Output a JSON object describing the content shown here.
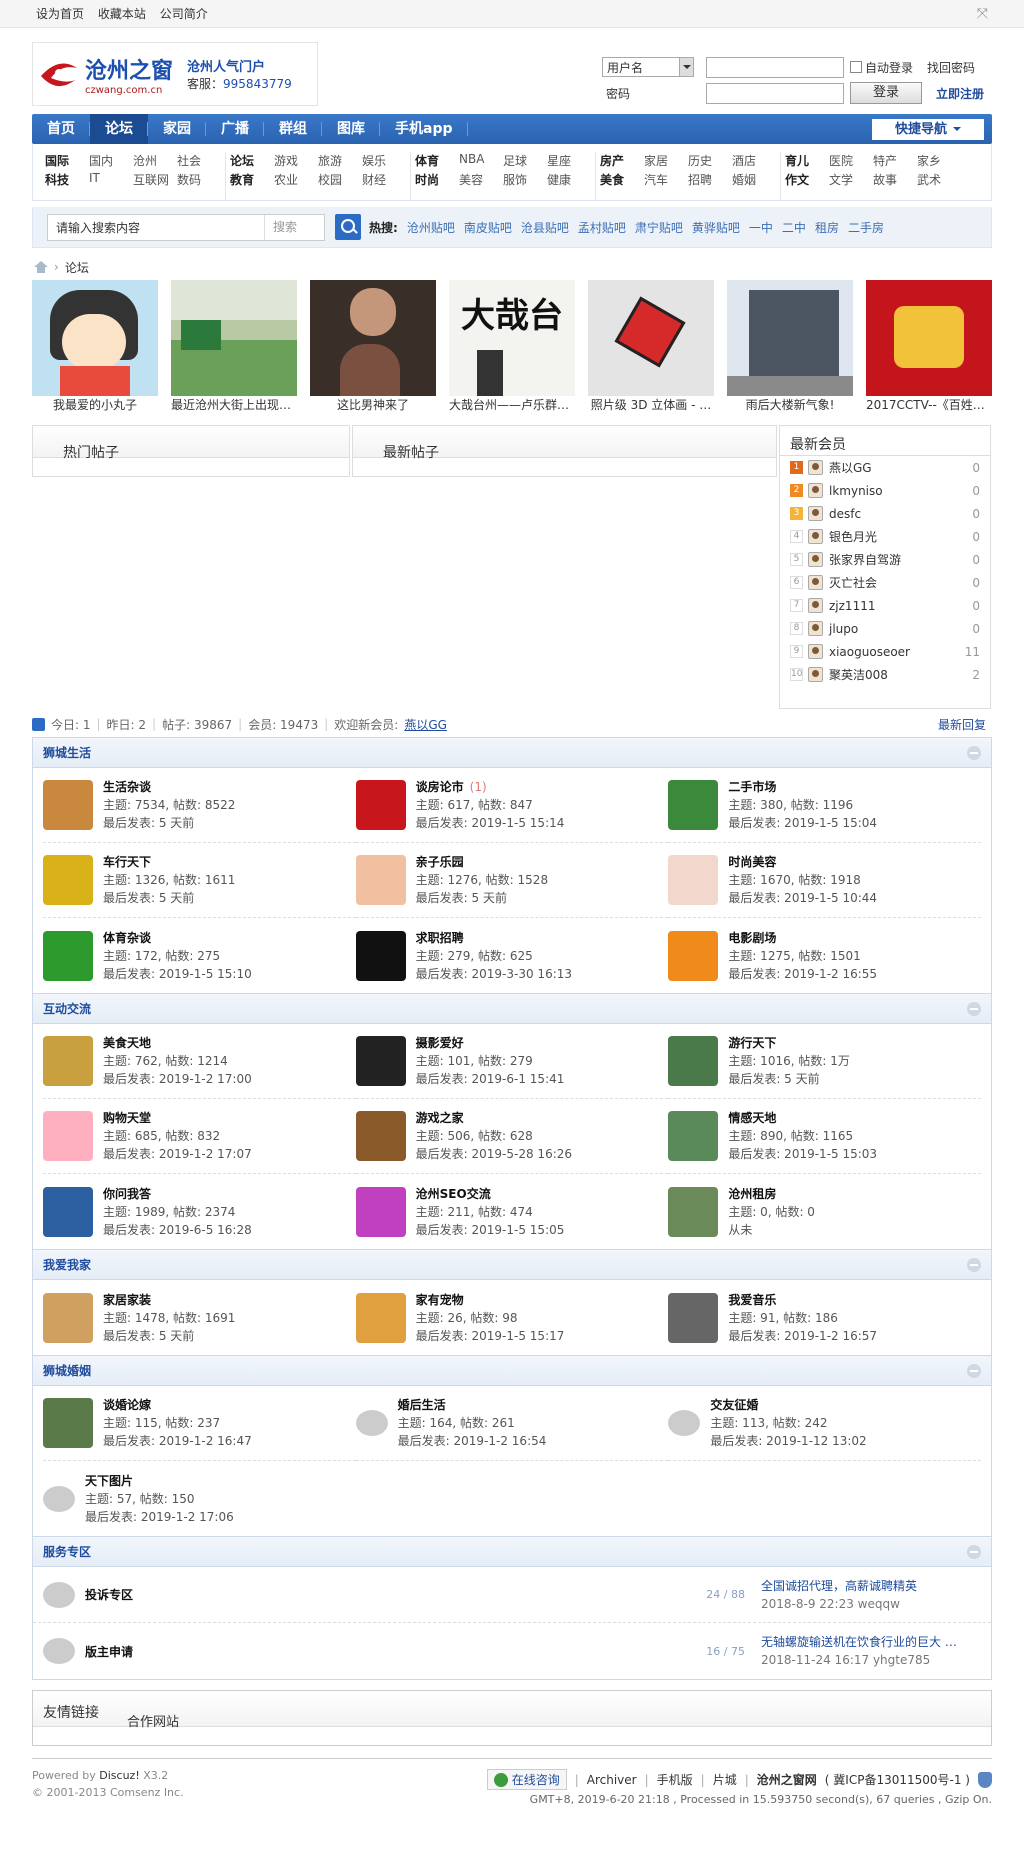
{
  "topbar": {
    "links": [
      "设为首页",
      "收藏本站",
      "公司简介"
    ]
  },
  "logo": {
    "name": "沧州之窗",
    "domain": "czwang.com.cn",
    "slogan": "沧州人气门户",
    "service_label": "客服：",
    "service_num": "995843779",
    "tagline": "沧州人气门户"
  },
  "login": {
    "user_type": "用户名",
    "pwd_label": "密码",
    "remember": "自动登录",
    "login_btn": "登录",
    "forgot": "找回密码",
    "register": "立即注册"
  },
  "nav": {
    "items": [
      "首页",
      "论坛",
      "家园",
      "广播",
      "群组",
      "图库",
      "手机app"
    ],
    "quick": "快捷导航"
  },
  "categories": [
    [
      "国际",
      "国内",
      "沧州",
      "社会",
      "科技",
      "IT",
      "互联网",
      "数码"
    ],
    [
      "论坛",
      "游戏",
      "旅游",
      "娱乐",
      "教育",
      "农业",
      "校园",
      "财经"
    ],
    [
      "体育",
      "NBA",
      "足球",
      "星座",
      "时尚",
      "美容",
      "服饰",
      "健康"
    ],
    [
      "房产",
      "家居",
      "历史",
      "酒店",
      "美食",
      "汽车",
      "招聘",
      "婚姻"
    ],
    [
      "育儿",
      "医院",
      "特产",
      "家乡",
      "作文",
      "文学",
      "故事",
      "武术"
    ]
  ],
  "search": {
    "placeholder": "请输入搜索内容",
    "type": "搜索",
    "hot_label": "热搜:",
    "hot": [
      "沧州贴吧",
      "南皮贴吧",
      "沧县贴吧",
      "孟村贴吧",
      "肃宁贴吧",
      "黄骅贴吧",
      "一中",
      "二中",
      "租房",
      "二手房"
    ]
  },
  "breadcrumb": {
    "current": "论坛"
  },
  "gallery": [
    {
      "cap": "我最爱的小丸子"
    },
    {
      "cap": "最近沧州大街上出现了…"
    },
    {
      "cap": "这比男神来了"
    },
    {
      "cap": "大哉台州——卢乐群书…"
    },
    {
      "cap": "照片级 3D 立体画 - …"
    },
    {
      "cap": "雨后大楼新气象!"
    },
    {
      "cap": "2017CCTV--《百姓春晚…"
    }
  ],
  "panels": {
    "hot": "热门帖子",
    "new": "最新帖子",
    "members": "最新会员"
  },
  "members": [
    {
      "r": "1",
      "n": "燕以GG",
      "c": "0"
    },
    {
      "r": "2",
      "n": "lkmyniso",
      "c": "0"
    },
    {
      "r": "3",
      "n": "desfc",
      "c": "0"
    },
    {
      "r": "4",
      "n": "银色月光",
      "c": "0"
    },
    {
      "r": "5",
      "n": "张家界自驾游",
      "c": "0"
    },
    {
      "r": "6",
      "n": "灭亡社会",
      "c": "0"
    },
    {
      "r": "7",
      "n": "zjz1111",
      "c": "0"
    },
    {
      "r": "8",
      "n": "jlupo",
      "c": "0"
    },
    {
      "r": "9",
      "n": "xiaoguoseoer",
      "c": "11"
    },
    {
      "r": "10",
      "n": "聚英洁008",
      "c": "2"
    }
  ],
  "stats": {
    "today": "今日: 1",
    "yesterday": "昨日: 2",
    "posts": "帖子: 39867",
    "members": "会员: 19473",
    "welcome": "欢迎新会员:",
    "newest": "燕以GG",
    "recent": "最新回复"
  },
  "sections": [
    {
      "title": "狮城生活",
      "forums": [
        {
          "n": "生活杂谈",
          "s": "主题: 7534, 帖数: 8522",
          "l": "最后发表: 5 天前"
        },
        {
          "n": "谈房论市",
          "x": "(1)",
          "s": "主题: 617, 帖数: 847",
          "l": "最后发表: 2019-1-5 15:14"
        },
        {
          "n": "二手市场",
          "s": "主题: 380, 帖数: 1196",
          "l": "最后发表: 2019-1-5 15:04"
        },
        {
          "n": "车行天下",
          "s": "主题: 1326, 帖数: 1611",
          "l": "最后发表: 5 天前"
        },
        {
          "n": "亲子乐园",
          "s": "主题: 1276, 帖数: 1528",
          "l": "最后发表: 5 天前"
        },
        {
          "n": "时尚美容",
          "s": "主题: 1670, 帖数: 1918",
          "l": "最后发表: 2019-1-5 10:44"
        },
        {
          "n": "体育杂谈",
          "s": "主题: 172, 帖数: 275",
          "l": "最后发表: 2019-1-5 15:10"
        },
        {
          "n": "求职招聘",
          "s": "主题: 279, 帖数: 625",
          "l": "最后发表: 2019-3-30 16:13"
        },
        {
          "n": "电影剧场",
          "s": "主题: 1275, 帖数: 1501",
          "l": "最后发表: 2019-1-2 16:55"
        }
      ]
    },
    {
      "title": "互动交流",
      "forums": [
        {
          "n": "美食天地",
          "s": "主题: 762, 帖数: 1214",
          "l": "最后发表: 2019-1-2 17:00"
        },
        {
          "n": "摄影爱好",
          "s": "主题: 101, 帖数: 279",
          "l": "最后发表: 2019-6-1 15:41"
        },
        {
          "n": "游行天下",
          "s": "主题: 1016, 帖数: 1万",
          "l": "最后发表: 5 天前"
        },
        {
          "n": "购物天堂",
          "s": "主题: 685, 帖数: 832",
          "l": "最后发表: 2019-1-2 17:07"
        },
        {
          "n": "游戏之家",
          "s": "主题: 506, 帖数: 628",
          "l": "最后发表: 2019-5-28 16:26"
        },
        {
          "n": "情感天地",
          "s": "主题: 890, 帖数: 1165",
          "l": "最后发表: 2019-1-5 15:03"
        },
        {
          "n": "你问我答",
          "s": "主题: 1989, 帖数: 2374",
          "l": "最后发表: 2019-6-5 16:28"
        },
        {
          "n": "沧州SEO交流",
          "s": "主题: 211, 帖数: 474",
          "l": "最后发表: 2019-1-5 15:05"
        },
        {
          "n": "沧州租房",
          "s": "主题: 0, 帖数: 0",
          "l": "从未"
        }
      ]
    },
    {
      "title": "我爱我家",
      "forums": [
        {
          "n": "家居家装",
          "s": "主题: 1478, 帖数: 1691",
          "l": "最后发表: 5 天前"
        },
        {
          "n": "家有宠物",
          "s": "主题: 26, 帖数: 98",
          "l": "最后发表: 2019-1-5 15:17"
        },
        {
          "n": "我爱音乐",
          "s": "主题: 91, 帖数: 186",
          "l": "最后发表: 2019-1-2 16:57"
        }
      ]
    },
    {
      "title": "狮城婚姻",
      "forums": [
        {
          "n": "谈婚论嫁",
          "s": "主题: 115, 帖数: 237",
          "l": "最后发表: 2019-1-2 16:47"
        },
        {
          "n": "婚后生活",
          "s": "主题: 164, 帖数: 261",
          "l": "最后发表: 2019-1-2 16:54"
        },
        {
          "n": "交友征婚",
          "s": "主题: 113, 帖数: 242",
          "l": "最后发表: 2019-1-12 13:02"
        },
        {
          "n": "天下图片",
          "s": "主题: 57, 帖数: 150",
          "l": "最后发表: 2019-1-2 17:06"
        }
      ]
    }
  ],
  "service": {
    "title": "服务专区",
    "items": [
      {
        "n": "投诉专区",
        "c": "24 / 88",
        "t": "全国诚招代理，高薪诚聘精英",
        "m": "2018-8-9 22:23 weqqw"
      },
      {
        "n": "版主申请",
        "c": "16 / 75",
        "t": "无轴螺旋输送机在饮食行业的巨大 …",
        "m": "2018-11-24 16:17 yhgte785"
      }
    ]
  },
  "friend": {
    "title": "友情链接",
    "sub": "合作网站"
  },
  "footer": {
    "powered": "Powered by",
    "discuz": "Discuz!",
    "ver": "X3.2",
    "copy": "© 2001-2013 Comsenz Inc.",
    "online": "在线咨询",
    "links": [
      "Archiver",
      "手机版",
      "片城"
    ],
    "brand": "沧州之窗网",
    "icp": "( 冀ICP备13011500号-1 )",
    "info": "GMT+8, 2019-6-20 21:18 , Processed in 15.593750 second(s), 67 queries , Gzip On."
  }
}
